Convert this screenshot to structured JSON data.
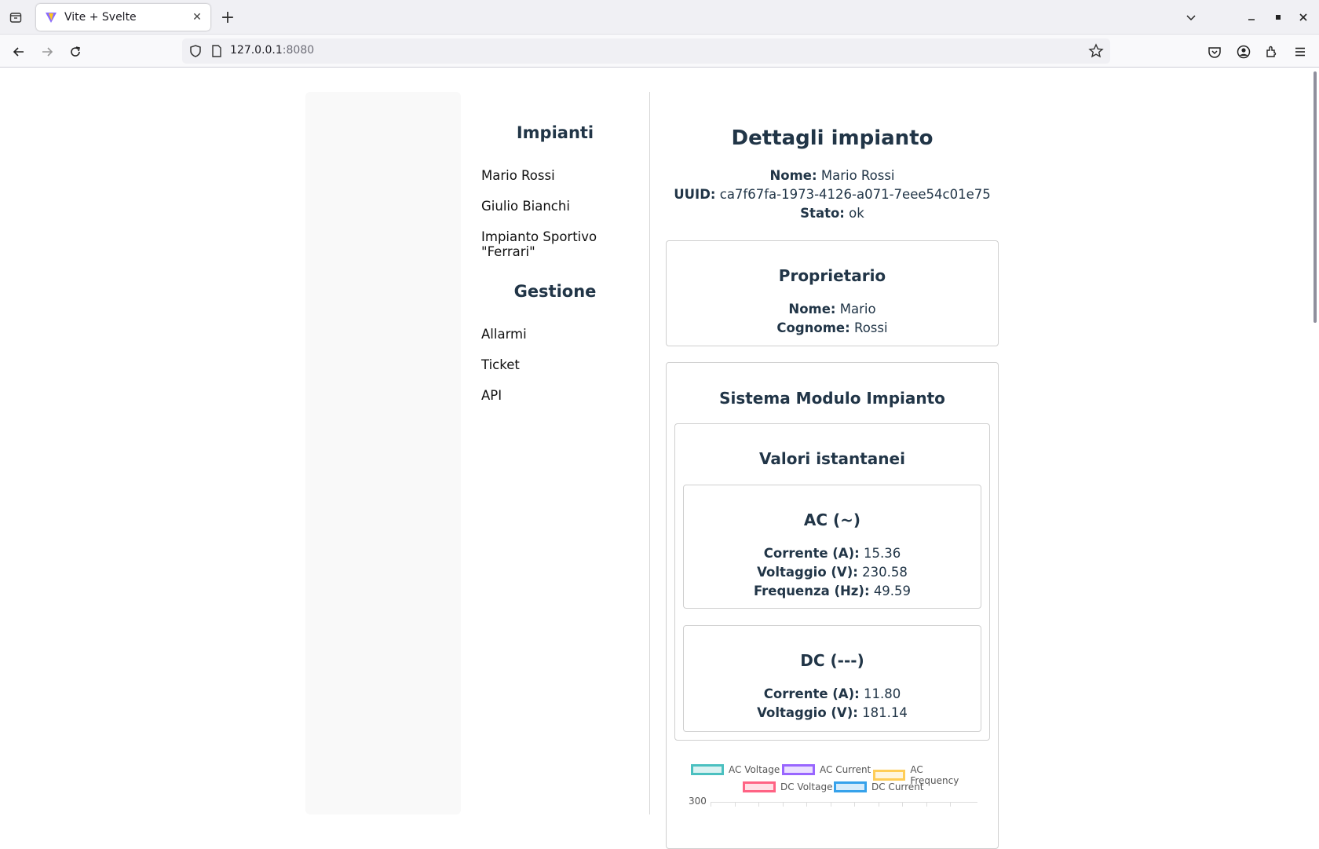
{
  "browser": {
    "tab_title": "Vite + Svelte",
    "url_host": "127.0.0.1",
    "url_port": ":8080"
  },
  "sidebar": {
    "section1_title": "Impianti",
    "section1_items": [
      "Mario Rossi",
      "Giulio Bianchi",
      "Impianto Sportivo \"Ferrari\""
    ],
    "section2_title": "Gestione",
    "section2_items": [
      "Allarmi",
      "Ticket",
      "API"
    ]
  },
  "details": {
    "title": "Dettagli impianto",
    "nome_label": "Nome:",
    "nome_value": "Mario Rossi",
    "uuid_label": "UUID:",
    "uuid_value": "ca7f67fa-1973-4126-a071-7eee54c01e75",
    "stato_label": "Stato:",
    "stato_value": "ok"
  },
  "owner": {
    "title": "Proprietario",
    "nome_label": "Nome:",
    "nome_value": "Mario",
    "cognome_label": "Cognome:",
    "cognome_value": "Rossi"
  },
  "system": {
    "title": "Sistema Modulo Impianto",
    "instant_title": "Valori istantanei",
    "ac": {
      "title": "AC (~)",
      "corrente_label": "Corrente (A):",
      "corrente_value": "15.36",
      "voltaggio_label": "Voltaggio (V):",
      "voltaggio_value": "230.58",
      "frequenza_label": "Frequenza (Hz):",
      "frequenza_value": "49.59"
    },
    "dc": {
      "title": "DC (---)",
      "corrente_label": "Corrente (A):",
      "corrente_value": "11.80",
      "voltaggio_label": "Voltaggio (V):",
      "voltaggio_value": "181.14"
    }
  },
  "chart_data": {
    "type": "line",
    "series": [
      {
        "name": "AC Voltage",
        "color": "#4bc0c0"
      },
      {
        "name": "AC Current",
        "color": "#9966ff"
      },
      {
        "name": "AC Frequency",
        "color": "#ffcd56"
      },
      {
        "name": "DC Voltage",
        "color": "#ff6384"
      },
      {
        "name": "DC Current",
        "color": "#36a2eb"
      }
    ],
    "y_tick_top": "300"
  }
}
